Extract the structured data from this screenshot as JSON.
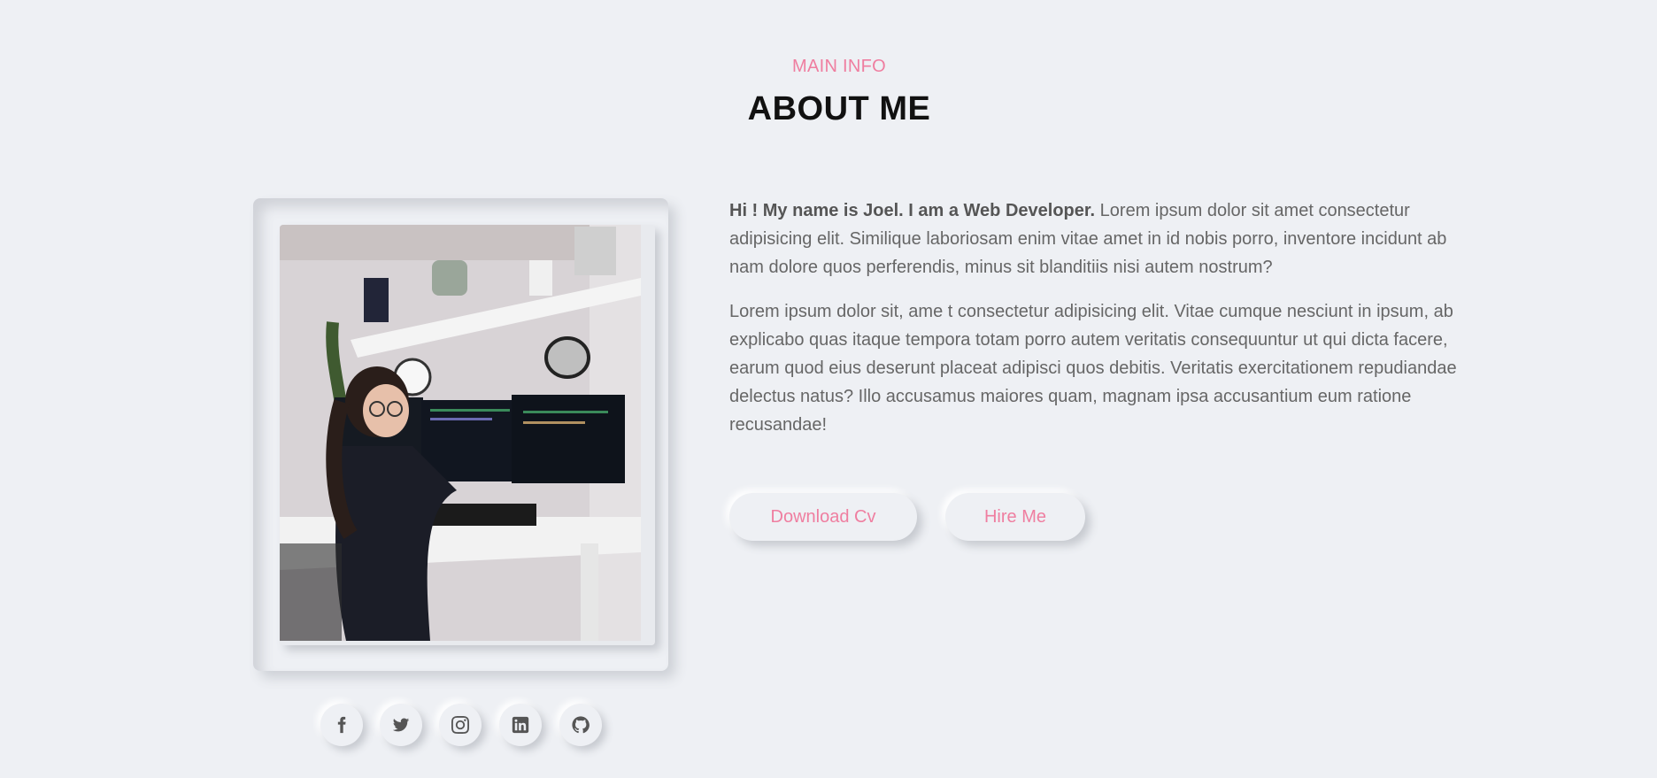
{
  "header": {
    "subtitle": "MAIN INFO",
    "title": "ABOUT ME"
  },
  "about": {
    "intro_bold": "Hi ! My name is Joel. I am a Web Developer.",
    "intro_rest": " Lorem ipsum dolor sit amet consectetur adipisicing elit. Similique laboriosam enim vitae amet in id nobis porro, inventore incidunt ab nam dolore quos perferendis, minus sit blanditiis nisi autem nostrum?",
    "paragraph2": "Lorem ipsum dolor sit, ame t consectetur adipisicing elit. Vitae cumque nesciunt in ipsum, ab explicabo quas itaque tempora totam porro autem veritatis consequuntur ut qui dicta facere, earum quod eius deserunt placeat adipisci quos debitis. Veritatis exercitationem repudiandae delectus natus? Illo accusamus maiores quam, magnam ipsa accusantium eum ratione recusandae!"
  },
  "buttons": {
    "download_cv": "Download Cv",
    "hire_me": "Hire Me"
  },
  "social": [
    {
      "icon": "facebook-icon"
    },
    {
      "icon": "twitter-icon"
    },
    {
      "icon": "instagram-icon"
    },
    {
      "icon": "linkedin-icon"
    },
    {
      "icon": "github-icon"
    }
  ],
  "colors": {
    "accent": "#ef7ea0",
    "background": "#eef0f4",
    "title": "#111111",
    "body_text": "#666666"
  }
}
